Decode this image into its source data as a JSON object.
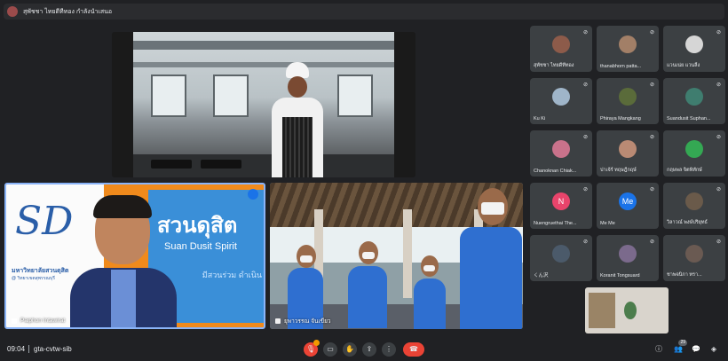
{
  "topbar": {
    "presenter_label": "สุพัชชา ไทยดีทีทอง กำลังนำเสนอ"
  },
  "main": {
    "presenter_name": "Paiphon Intawirat",
    "presenter_logo": "SD",
    "presenter_uni": "มหาวิทยาลัยสวนดุสิต",
    "presenter_uni_sub": "@ วิทยาเขตสุพรรณบุรี",
    "banner_big": "สวนดุสิต",
    "banner_sub": "Suan Dusit Spirit",
    "banner_side": "มีสวนร่วม ดำเนิน",
    "students_name": "ยุพาวรรณ จันเขียว"
  },
  "participants": [
    {
      "name": "สุพัชชา ไทยดีทีทอง",
      "avatar_color": "#8d5b4a"
    },
    {
      "name": "thanabhorn patta...",
      "avatar_color": "#a27f67"
    },
    {
      "name": "แวนเน่ย แวนลิ้ง",
      "avatar_color": "#d6d6d6"
    },
    {
      "name": "Ku Ki",
      "avatar_color": "#9fb5c9"
    },
    {
      "name": "Phiraya Mangkang",
      "avatar_color": "#5a6b3a"
    },
    {
      "name": "Suandusit Suphan...",
      "avatar_color": "#3f7d6f"
    },
    {
      "name": "Chanoknan Chiak...",
      "avatar_color": "#c9728b"
    },
    {
      "name": "ปาเจ้ร์ ทฤษฎีกฤษ์",
      "avatar_color": "#b98a74"
    },
    {
      "name": "กฤษพล จิตพิทักษ์",
      "avatar_color": "#34a853"
    },
    {
      "name": "Nuengruethai The...",
      "avatar_color": "#e8446b",
      "initial": "N"
    },
    {
      "name": "Me Me",
      "avatar_color": "#1a73e8",
      "initial": "Me"
    },
    {
      "name": "วิลาวณ์ พงษ์ปริยุทธ์",
      "avatar_color": "#6a5a4a"
    },
    {
      "name": "くん沢",
      "avatar_color": "#4b5a6a"
    },
    {
      "name": "Koranit Tongsuard",
      "avatar_color": "#7b6a8c"
    },
    {
      "name": "ชาพจนิกา ทรา...",
      "avatar_color": "#6a5a52"
    }
  ],
  "bottombar": {
    "time": "09:04",
    "meeting_code": "gta-cvtw-sib",
    "participants_count": "29"
  },
  "colors": {
    "end_call": "#ea4335",
    "accent": "#8ab4f8"
  }
}
